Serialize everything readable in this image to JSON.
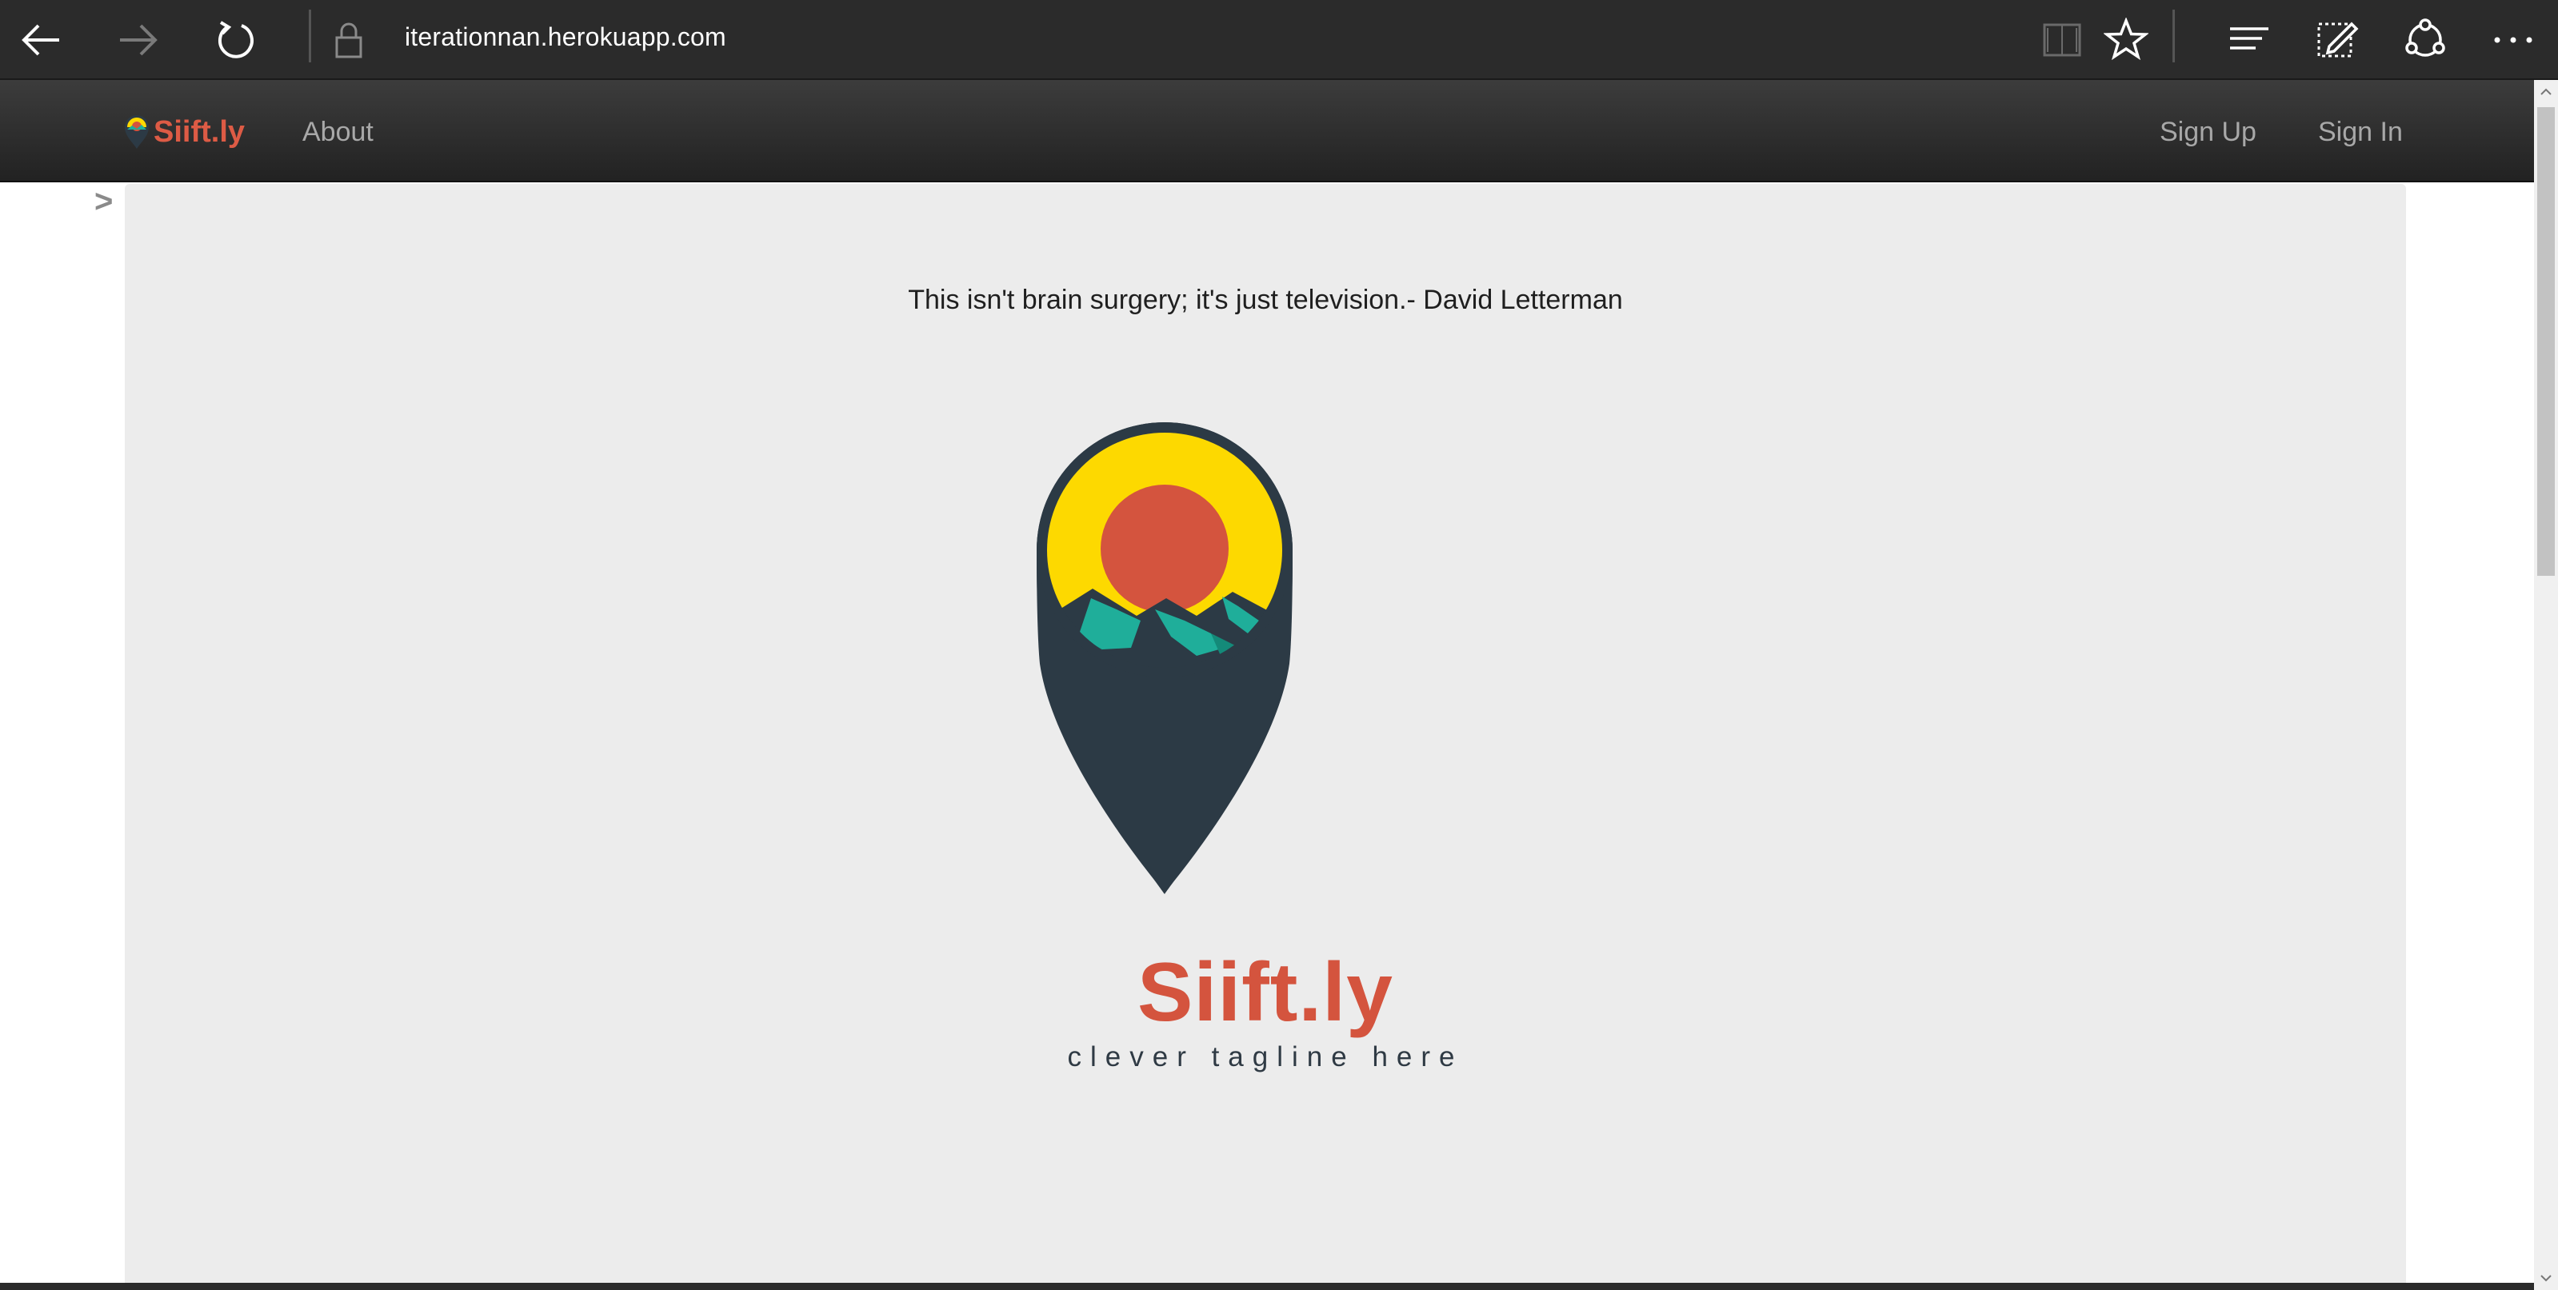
{
  "browser": {
    "url": "iterationnan.herokuapp.com",
    "icons": {
      "back": "back-arrow-icon",
      "forward": "forward-arrow-icon",
      "refresh": "refresh-icon",
      "lock": "lock-icon",
      "reading_view": "book-icon",
      "favorite": "star-icon",
      "hub": "hub-lines-icon",
      "web_note": "pen-note-icon",
      "share": "share-icon",
      "more": "ellipsis-icon"
    }
  },
  "navbar": {
    "brand": "Siift.ly",
    "links": {
      "about": "About",
      "sign_up": "Sign Up",
      "sign_in": "Sign In"
    }
  },
  "content": {
    "toggle": ">",
    "quote": "This isn't brain surgery; it's just television.- David Letterman",
    "logo_brand": "Siift.ly",
    "logo_tagline": "clever tagline here"
  },
  "colors": {
    "brand_red": "#d4543e",
    "sun_yellow": "#fdd900",
    "mountain_teal": "#1fae9a",
    "pin_dark": "#2c3a45",
    "panel_bg": "#ececec"
  }
}
